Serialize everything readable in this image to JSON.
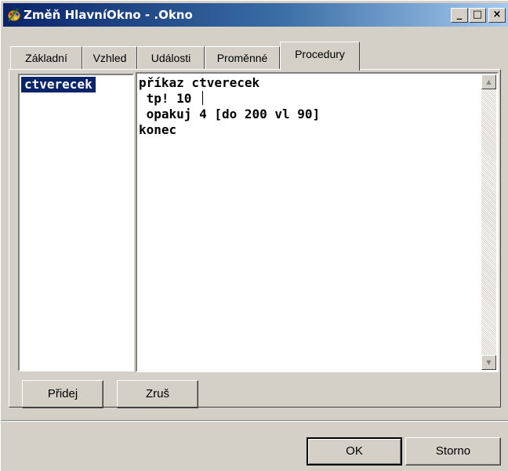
{
  "window": {
    "title": "Změň HlavníOkno - .Okno",
    "minimize_glyph": "_",
    "maximize_glyph": "□",
    "close_glyph": "×",
    "app_icon": "paint-palette-icon"
  },
  "tabs": [
    {
      "label": "Základní",
      "active": false
    },
    {
      "label": "Vzhled",
      "active": false
    },
    {
      "label": "Události",
      "active": false
    },
    {
      "label": "Proměnné",
      "active": false
    },
    {
      "label": "Procedury",
      "active": true
    }
  ],
  "procedures": {
    "items": [
      "ctverecek"
    ],
    "selected": "ctverecek"
  },
  "editor": {
    "lines": [
      "příkaz ctverecek",
      " tp! 10 ",
      " opakuj 4 [do 200 vl 90]",
      "konec"
    ],
    "scroll_up_glyph": "▲",
    "scroll_down_glyph": "▼"
  },
  "buttons": {
    "add": "Přidej",
    "delete": "Zruš",
    "ok": "OK",
    "cancel": "Storno"
  },
  "colors": {
    "face": "#d4d0c8",
    "title_gradient_start": "#0a246a",
    "title_gradient_end": "#a6caf0",
    "selection": "#0a246a"
  }
}
